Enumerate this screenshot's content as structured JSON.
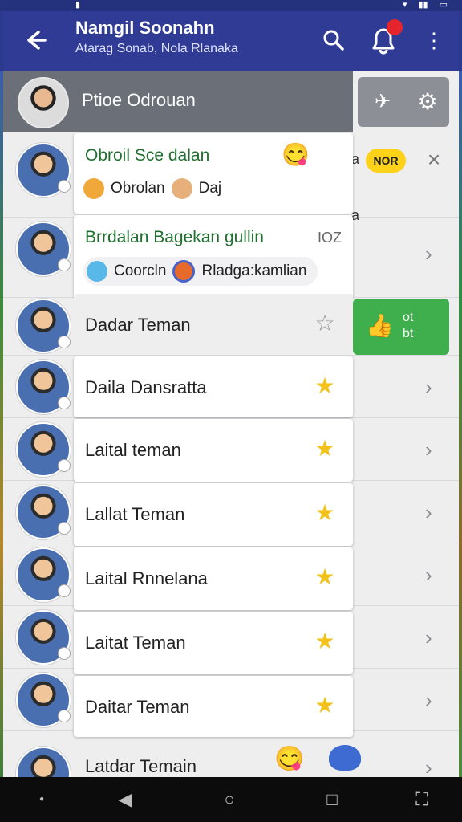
{
  "app": {
    "title": "Namgil Soonahn",
    "subtitle": "Atarag Sonab, Nola Rlanaka"
  },
  "profile": {
    "name": "Ptioe Odrouan"
  },
  "cards": [
    {
      "title": "Obroil Sce dalan",
      "pills": [
        "Obrolan",
        "Daj"
      ]
    },
    {
      "title": "Brrdalan Bagekan gullin",
      "suffix": "IOZ",
      "pills": [
        "Coorcln",
        "Rladga:kamlian"
      ]
    }
  ],
  "menu_items": [
    {
      "label": "Dadar Teman",
      "starred": false
    },
    {
      "label": "Daila Dansratta",
      "starred": true
    },
    {
      "label": "Laital teman",
      "starred": true
    },
    {
      "label": "Lallat Teman",
      "starred": true
    },
    {
      "label": "Laital Rnnelana",
      "starred": true
    },
    {
      "label": "Laitat Teman",
      "starred": true
    },
    {
      "label": "Daitar Teman",
      "starred": true
    }
  ],
  "bottom_row": {
    "label": "Latdar Temain"
  },
  "right_panel": {
    "badge": "NOR",
    "green_card_line1": "ot",
    "green_card_line2": "bt",
    "letters": [
      "a",
      "a"
    ]
  },
  "icons": [
    "back-arrow-icon",
    "search-icon",
    "notification-bell-icon",
    "more-vert-icon",
    "pin-icon",
    "gear-icon",
    "star-icon",
    "chevron-right-icon",
    "close-icon"
  ],
  "colors": {
    "appbar": "#2f3b95",
    "accent_green": "#3fae4c",
    "star": "#f2c21b",
    "badge_yellow": "#ffd21a",
    "notif_red": "#e5252c"
  }
}
